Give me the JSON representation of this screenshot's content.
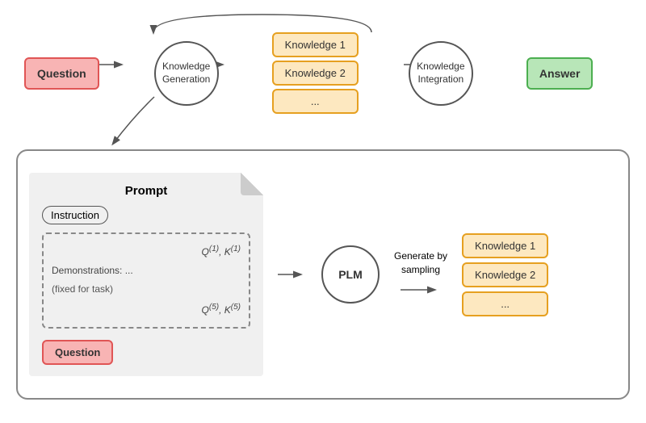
{
  "top": {
    "question_label": "Question",
    "knowledge_gen_label": "Knowledge\nGeneration",
    "knowledge_items": [
      "Knowledge 1",
      "Knowledge 2",
      "..."
    ],
    "knowledge_int_label": "Knowledge\nIntegration",
    "answer_label": "Answer"
  },
  "bottom": {
    "prompt_title": "Prompt",
    "instruction_label": "Instruction",
    "demonstrations_label": "Demonstrations:",
    "demonstrations_sub": "(fixed for task)",
    "demo_q1": "Q",
    "demo_k1": "K",
    "demo_sup1": "(1)",
    "demo_dots": "...",
    "demo_q5": "Q",
    "demo_k5": "K",
    "demo_sup5": "(5)",
    "question_label": "Question",
    "plm_label": "PLM",
    "generate_label": "Generate by\nsampling",
    "knowledge_items": [
      "Knowledge 1",
      "Knowledge 2",
      "..."
    ]
  },
  "colors": {
    "question_bg": "#f8b4b4",
    "question_border": "#e05555",
    "answer_bg": "#b8e6b8",
    "answer_border": "#4caf50",
    "knowledge_bg": "#fde8c0",
    "knowledge_border": "#e6a020"
  }
}
